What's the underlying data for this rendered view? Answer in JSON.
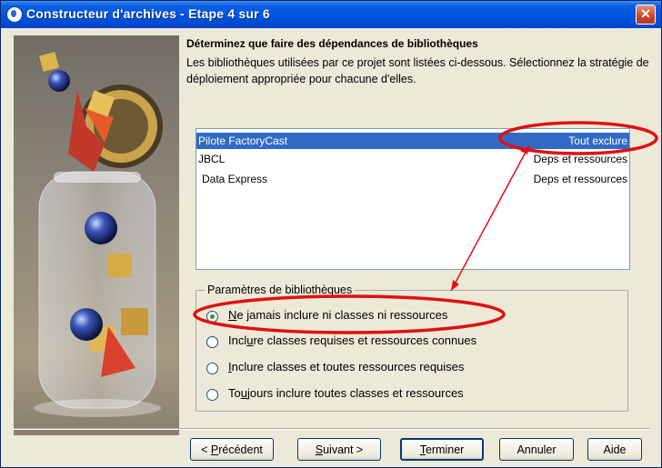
{
  "window": {
    "title": "Constructeur d'archives - Etape 4 sur 6",
    "close_glyph": "✕"
  },
  "main": {
    "heading": "Déterminez que faire des dépendances de bibliothèques",
    "description": "Les bibliothèques utilisées par ce projet sont listées ci-dessous. Sélectionnez la stratégie de déploiement appropriée pour chacune d'elles.",
    "libraries": [
      {
        "name": "Pilote FactoryCast",
        "strategy": "Tout exclure",
        "selected": true
      },
      {
        "name": "JBCL",
        "strategy": "Deps et ressources",
        "selected": false
      },
      {
        "name": "Data Express",
        "strategy": "Deps et ressources",
        "selected": false
      }
    ]
  },
  "settings": {
    "group_label": "Paramètres de bibliothèques",
    "options": [
      {
        "mnemonic": "N",
        "rest": "e jamais inclure ni classes ni ressources",
        "checked": true
      },
      {
        "mnemonic": "",
        "prefix": "Incl",
        "mnemonic_mid": "u",
        "rest": "re classes requises et ressources connues",
        "checked": false
      },
      {
        "mnemonic": "I",
        "rest": "nclure classes et toutes ressources requises",
        "checked": false
      },
      {
        "mnemonic": "",
        "prefix": "To",
        "mnemonic_mid": "u",
        "rest": "jours inclure toutes classes et ressources",
        "checked": false
      }
    ]
  },
  "buttons": {
    "previous": {
      "prefix": "< ",
      "mnemonic": "P",
      "rest": "récédent"
    },
    "next": {
      "prefix": "",
      "mnemonic": "S",
      "rest": "uivant >"
    },
    "finish": {
      "prefix": "",
      "mnemonic": "T",
      "rest": "erminer"
    },
    "cancel": {
      "label": "Annuler"
    },
    "help": {
      "label": "Aide"
    }
  },
  "annotation": {
    "color": "#e01010"
  },
  "icons": [
    "app-icon",
    "close-icon",
    "wizard-illustration",
    "radio-icon"
  ]
}
